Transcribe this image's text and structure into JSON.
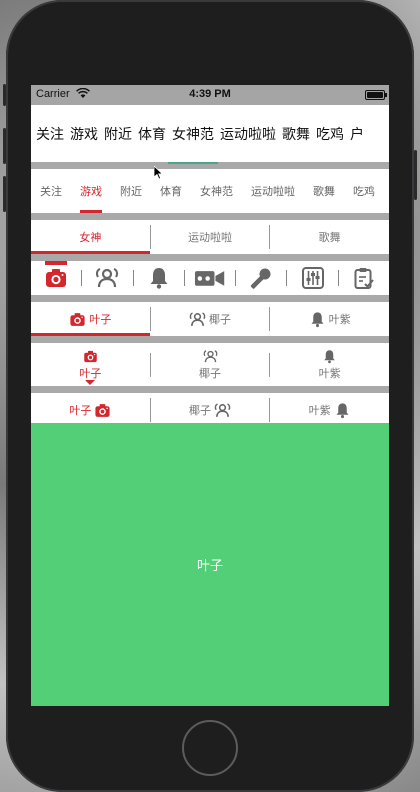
{
  "status_bar": {
    "carrier": "Carrier",
    "time": "4:39 PM"
  },
  "row1": {
    "tabs": [
      "关注",
      "游戏",
      "附近",
      "体育",
      "女神范",
      "运动啦啦",
      "歌舞",
      "吃鸡",
      "户"
    ],
    "active_index": 4,
    "indicator_color": "#4aa58d"
  },
  "row2": {
    "tabs": [
      "关注",
      "游戏",
      "附近",
      "体育",
      "女神范",
      "运动啦啦",
      "歌舞",
      "吃鸡"
    ],
    "active_index": 1
  },
  "seg_text": {
    "items": [
      "女神",
      "运动啦啦",
      "歌舞"
    ],
    "active_index": 0
  },
  "icon_row": {
    "icons": [
      "camera-icon",
      "people-icon",
      "bell-icon",
      "video-icon",
      "microphone-icon",
      "sliders-icon",
      "clipboard-icon"
    ],
    "active_index": 0
  },
  "seg_icon_left": {
    "items": [
      "叶子",
      "椰子",
      "叶紫"
    ],
    "icons": [
      "camera-icon",
      "people-icon",
      "bell-icon"
    ],
    "active_index": 0
  },
  "seg_icon_top": {
    "items": [
      "叶子",
      "椰子",
      "叶紫"
    ],
    "icons": [
      "camera-icon",
      "people-icon",
      "bell-icon"
    ],
    "active_index": 0
  },
  "seg_icon_right": {
    "items": [
      "叶子",
      "椰子",
      "叶紫"
    ],
    "icons": [
      "camera-icon",
      "people-icon",
      "bell-icon"
    ],
    "active_index": 0
  },
  "content": {
    "label": "叶子",
    "background": "#52cf77"
  },
  "colors": {
    "accent_red": "#d4262d",
    "accent_green": "#4aa58d",
    "icon_gray": "#666666"
  }
}
